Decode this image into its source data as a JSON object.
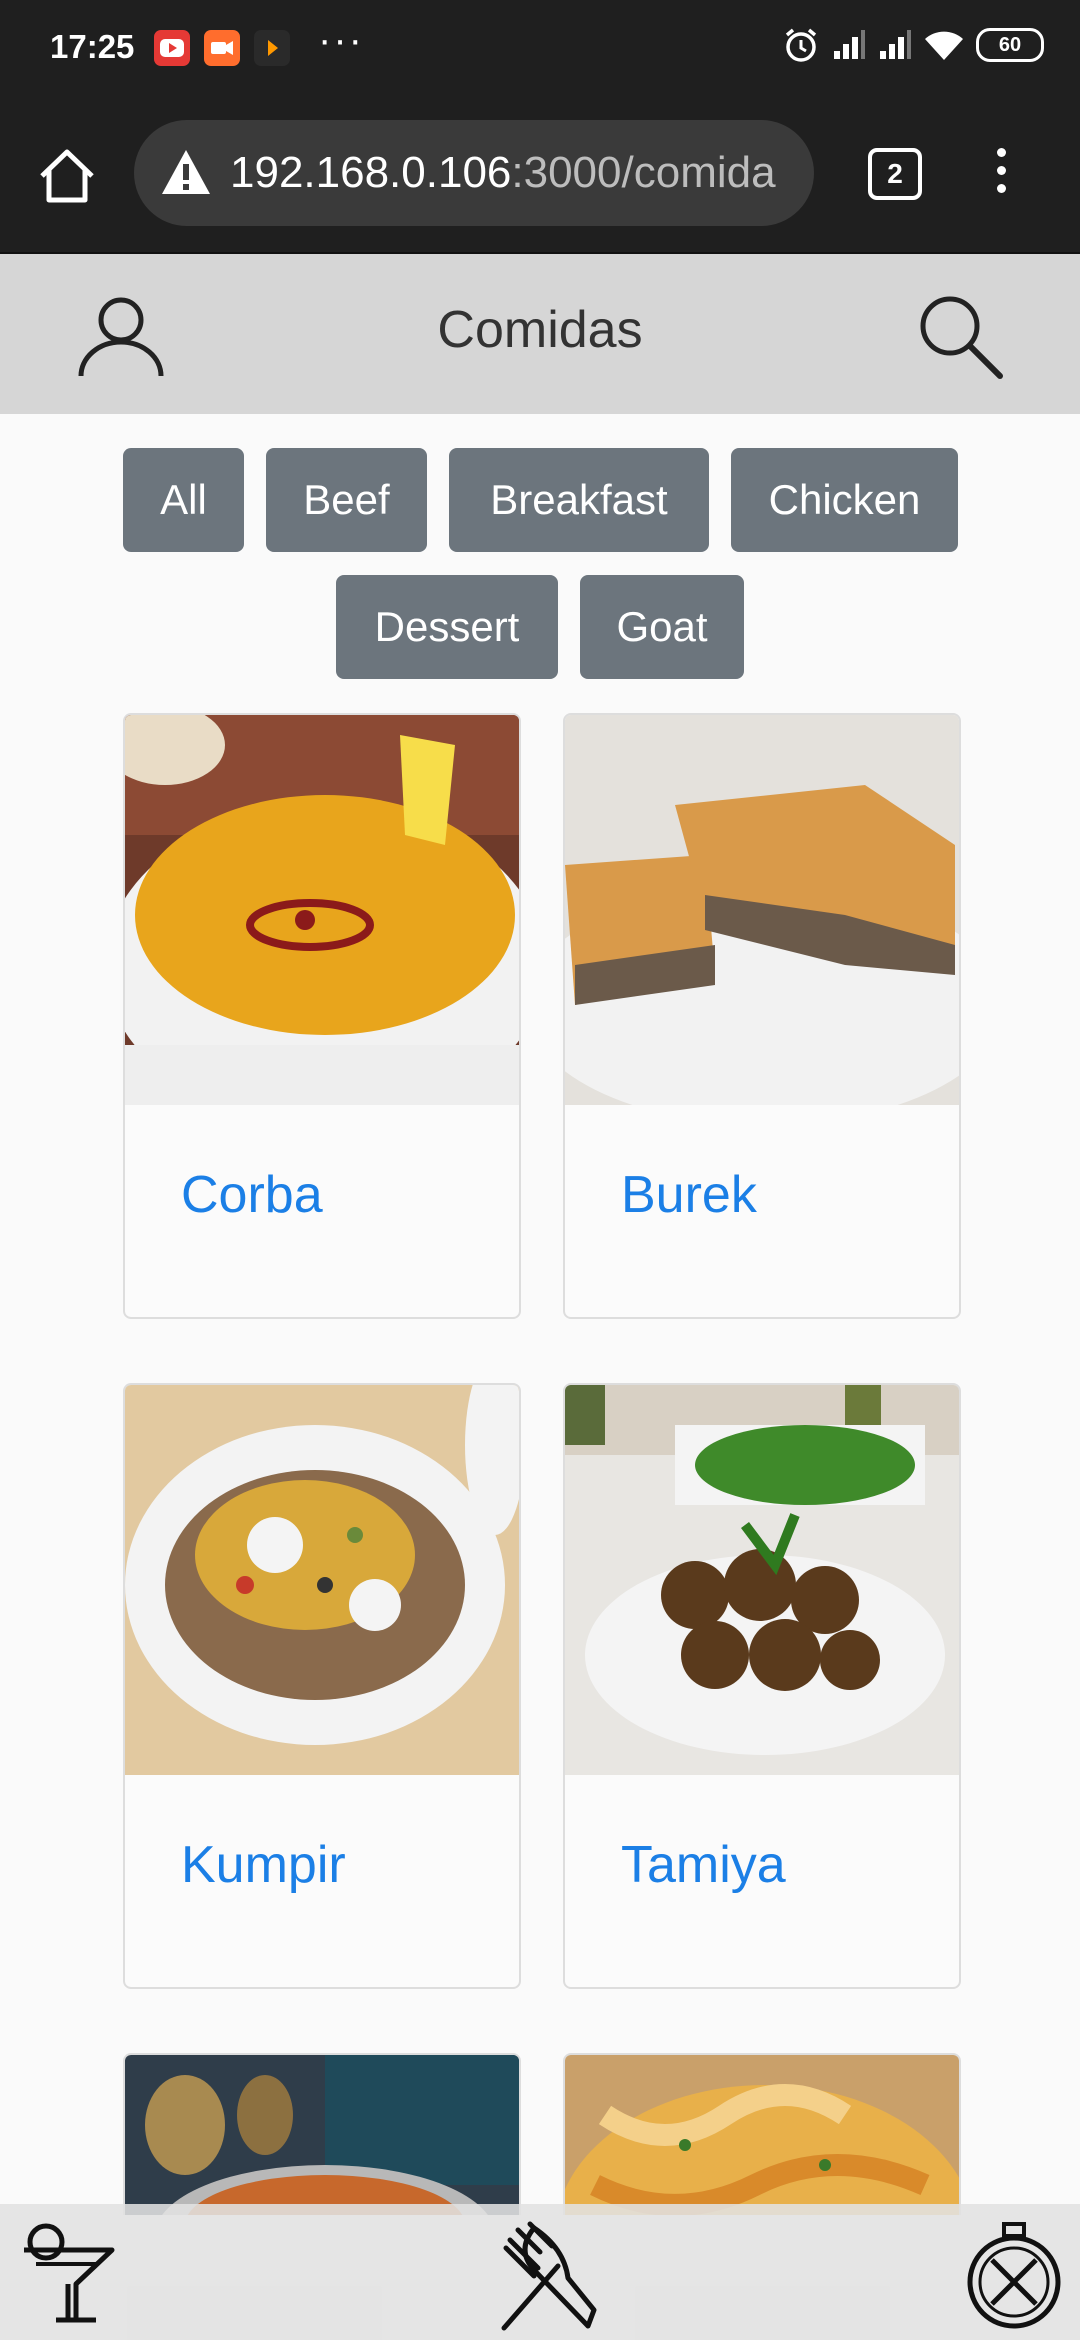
{
  "status_bar": {
    "time": "17:25",
    "more": "···",
    "battery": "60",
    "icons": [
      "youtube-icon",
      "video-app-icon",
      "play-app-icon",
      "alarm-icon",
      "signal-icon",
      "signal-icon",
      "wifi-icon",
      "battery-icon"
    ]
  },
  "browser": {
    "url_host": "192.168.0.106",
    "url_path": ":3000/comida",
    "tab_count": "2",
    "icons": [
      "home-icon",
      "warning-icon",
      "tabs-icon",
      "more-menu-icon"
    ]
  },
  "header": {
    "title": "Comidas",
    "icons": [
      "user-icon",
      "search-icon"
    ]
  },
  "filters": [
    {
      "label": "All"
    },
    {
      "label": "Beef"
    },
    {
      "label": "Breakfast"
    },
    {
      "label": "Chicken"
    },
    {
      "label": "Dessert"
    },
    {
      "label": "Goat"
    }
  ],
  "cards": [
    {
      "name": "Corba",
      "image": "lentil-soup-photo"
    },
    {
      "name": "Burek",
      "image": "burek-pastry-photo"
    },
    {
      "name": "Kumpir",
      "image": "stuffed-potato-photo"
    },
    {
      "name": "Tamiya",
      "image": "falafel-photo"
    },
    {
      "name": "",
      "image": "soup-pot-photo"
    },
    {
      "name": "",
      "image": "pasta-dish-photo"
    }
  ],
  "bottom_nav": {
    "icons": [
      "cocktail-icon",
      "fork-knife-icon",
      "explore-compass-icon"
    ]
  },
  "colors": {
    "status_bg": "#1f1f1f",
    "header_bg": "#d6d6d6",
    "filter_bg": "#6c757d",
    "link": "#1b7fe6"
  }
}
